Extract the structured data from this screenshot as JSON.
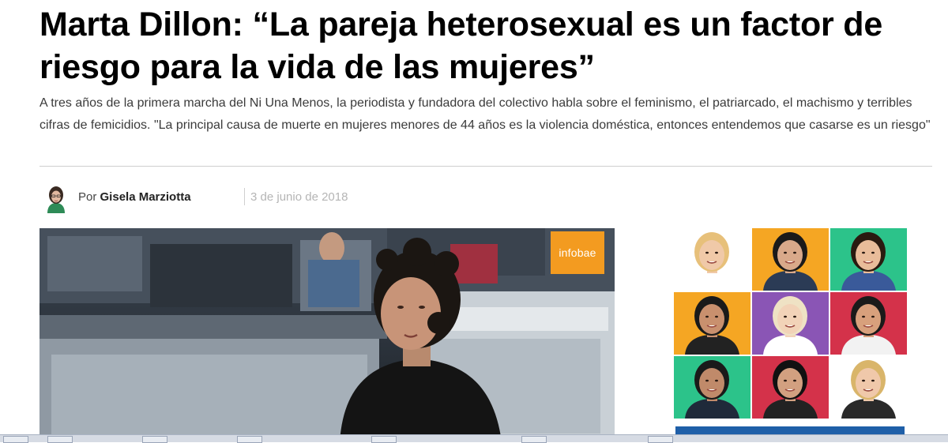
{
  "article": {
    "headline": "Marta Dillon: “La pareja heterosexual es un factor de riesgo para la vida de las mujeres”",
    "lead": "A tres años de la primera marcha del Ni Una Menos, la periodista y fundadora del colectivo habla sobre el feminismo, el patriarcado, el machismo y terribles cifras de femicidios. \"La principal causa de muerte en mujeres menores de 44 años es la violencia doméstica, entonces entendemos que casarse es un riesgo\"",
    "byline_prefix": "Por",
    "author": "Gisela Marziotta",
    "date": "3 de junio de 2018"
  },
  "video": {
    "brand_logo": "infobae"
  },
  "colors": {
    "brand_orange": "#f39b20",
    "promo_orange": "#f5a623",
    "promo_green": "#2cc38a",
    "promo_purple": "#8a55b5",
    "promo_red": "#d4324a"
  },
  "promo": {
    "tiles": [
      {
        "color": "#ffffff",
        "icon": "person-photo"
      },
      {
        "color": "#f5a623",
        "icon": "person-photo"
      },
      {
        "color": "#2cc38a",
        "icon": "person-photo"
      },
      {
        "color": "#f5a623",
        "icon": "person-photo"
      },
      {
        "color": "#8a55b5",
        "icon": "person-photo"
      },
      {
        "color": "#d4324a",
        "icon": "person-photo"
      },
      {
        "color": "#2cc38a",
        "icon": "person-photo"
      },
      {
        "color": "#d4324a",
        "icon": "person-photo"
      },
      {
        "color": "#ffffff",
        "icon": "person-photo"
      }
    ]
  }
}
